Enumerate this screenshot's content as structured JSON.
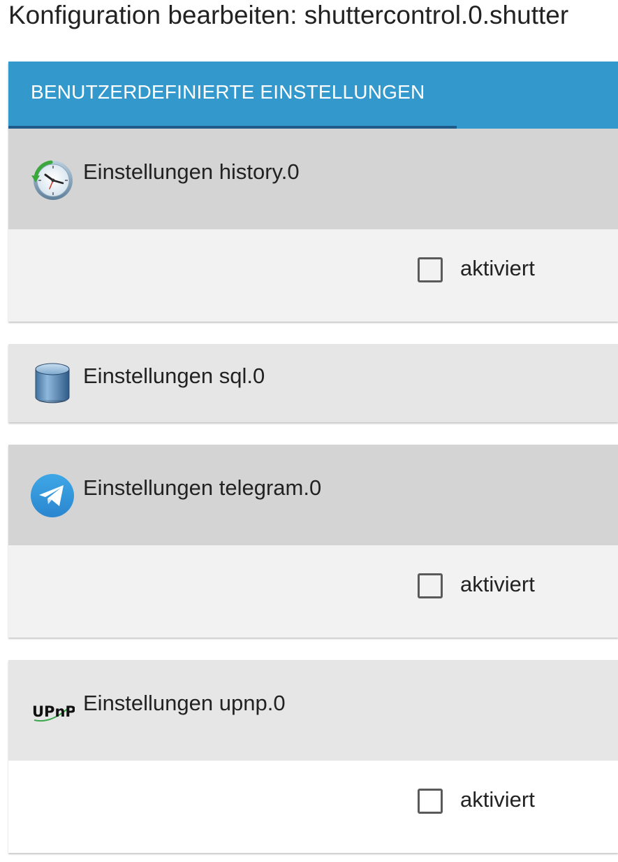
{
  "dialog": {
    "title": "Konfiguration bearbeiten: shuttercontrol.0.shutter"
  },
  "tabs": [
    {
      "label": "BENUTZERDEFINIERTE EINSTELLUNGEN",
      "active": true
    }
  ],
  "colors": {
    "tabbar_bg": "#3399cc",
    "tab_indicator": "#1e5a8a",
    "panel_header_expanded": "#d4d4d4",
    "panel_header_collapsed": "#e6e6e6",
    "panel_body": "#f2f2f2",
    "panel_body_upnp": "#ffffff"
  },
  "panels": [
    {
      "title": "Einstellungen history.0",
      "icon": "history-clock-icon",
      "expanded": true,
      "checkbox": {
        "label": "aktiviert",
        "checked": false
      }
    },
    {
      "title": "Einstellungen sql.0",
      "icon": "database-cylinder-icon",
      "expanded": false
    },
    {
      "title": "Einstellungen telegram.0",
      "icon": "telegram-icon",
      "expanded": true,
      "checkbox": {
        "label": "aktiviert",
        "checked": false
      }
    },
    {
      "title": "Einstellungen upnp.0",
      "icon": "upnp-logo-icon",
      "icon_text": "UPnP",
      "expanded": true,
      "checkbox": {
        "label": "aktiviert",
        "checked": false
      }
    }
  ]
}
